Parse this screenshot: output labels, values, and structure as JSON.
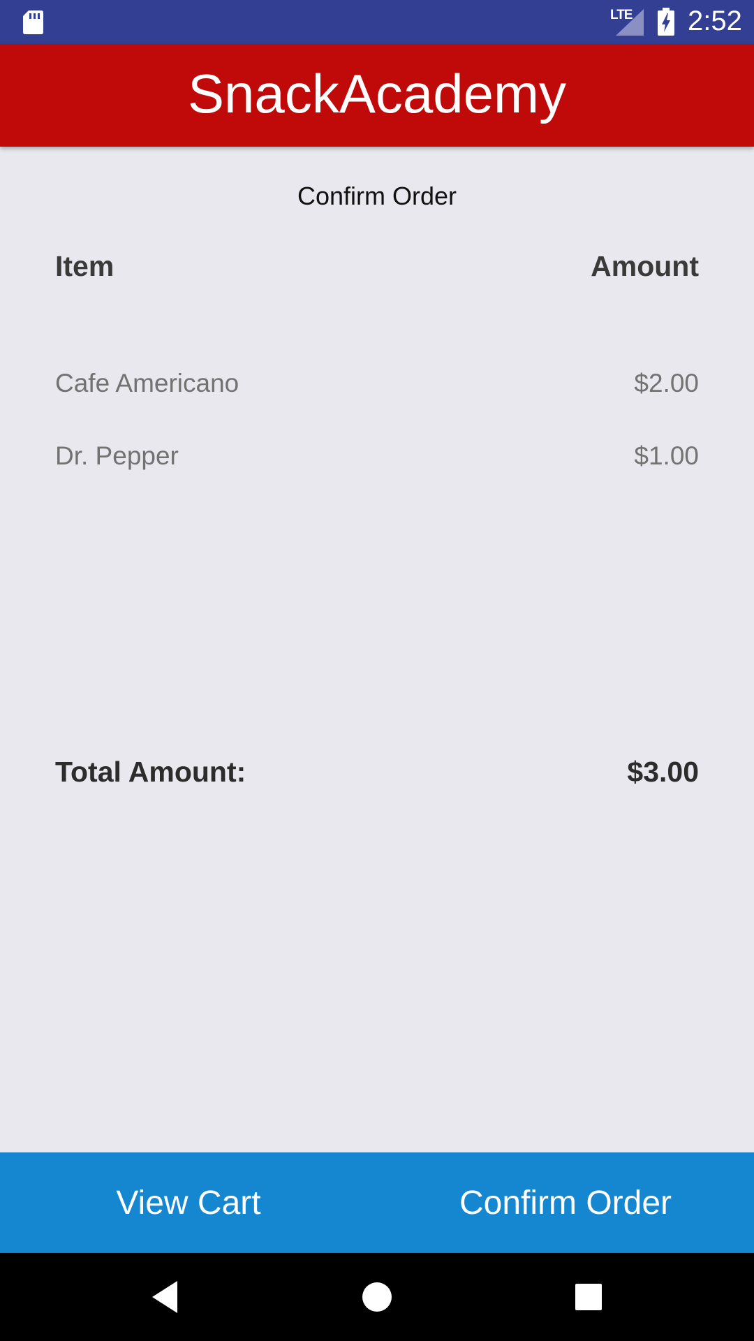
{
  "status_bar": {
    "network_label": "LTE",
    "time": "2:52",
    "icons": [
      "sd-card-icon",
      "signal-icon",
      "battery-charging-icon"
    ]
  },
  "app_bar": {
    "title": "SnackAcademy",
    "color": "#c00a0a"
  },
  "page": {
    "heading": "Confirm Order"
  },
  "table": {
    "columns": [
      "Item",
      "Amount"
    ],
    "rows": [
      {
        "item": "Cafe Americano",
        "amount": "$2.00"
      },
      {
        "item": "Dr. Pepper",
        "amount": "$1.00"
      }
    ]
  },
  "total": {
    "label": "Total Amount:",
    "value": "$3.00"
  },
  "bottom_bar": {
    "color": "#1587d0",
    "view_cart_label": "View Cart",
    "confirm_order_label": "Confirm Order"
  },
  "nav_bar": {
    "icons": [
      "back-icon",
      "home-icon",
      "recents-icon"
    ]
  }
}
